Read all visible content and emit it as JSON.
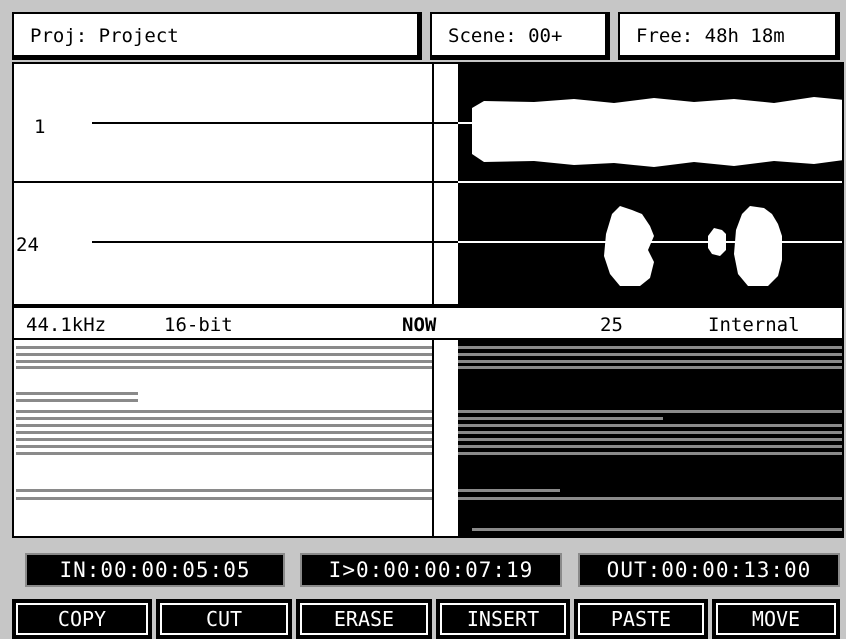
{
  "header": {
    "project": "Proj: Project",
    "scene": "Scene: 00+",
    "free": "Free: 48h 18m"
  },
  "tracks": [
    {
      "label": "1"
    },
    {
      "label": "24"
    }
  ],
  "status": {
    "sample_rate": "44.1kHz",
    "bit_depth": "16-bit",
    "now": "NOW",
    "frame_rate": "25",
    "sync": "Internal"
  },
  "timecodes": {
    "in": "IN:00:00:05:05",
    "now": "I>0:00:00:07:19",
    "out": "OUT:00:00:13:00"
  },
  "function_keys": [
    "COPY",
    "CUT",
    "ERASE",
    "INSERT",
    "PASTE",
    "MOVE"
  ],
  "colors": {
    "background": "#c6c6c6",
    "display": "#ffffff",
    "ink": "#000000",
    "overview_bar": "#8a8a8a"
  }
}
